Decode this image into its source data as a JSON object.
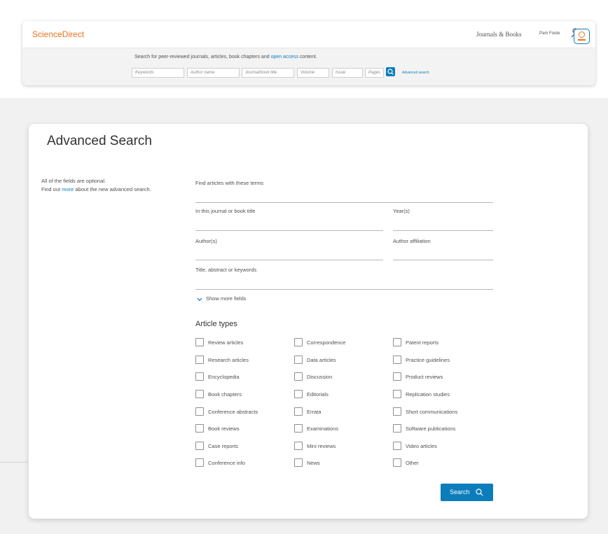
{
  "header": {
    "brand": "ScienceDirect",
    "journals_books": "Journals & Books",
    "user_name": "Pam Foote",
    "search_intro": "Search for peer-reviewed journals, articles, book chapters and",
    "search_intro_link": "open access",
    "search_intro_end": "content.",
    "quick_search": {
      "keywords": "Keywords",
      "author": "Author name",
      "journal": "Journal/book title",
      "volume": "Volume",
      "issue": "Issue",
      "pages": "Pages"
    },
    "advanced_link": "Advanced search"
  },
  "advanced": {
    "title": "Advanced Search",
    "note_line1": "All of the fields are optional.",
    "note_find": "Find out",
    "note_more": "more",
    "note_rest": "about the new advanced search.",
    "fields": {
      "terms": "Find articles with these terms",
      "journal": "In this journal or book title",
      "years": "Year(s)",
      "authors": "Author(s)",
      "affiliation": "Author affiliation",
      "title_abstract": "Title, abstract or keywords"
    },
    "show_more": "Show more fields",
    "article_types_heading": "Article types",
    "article_types": [
      [
        "Review articles",
        "Correspondence",
        "Patent reports"
      ],
      [
        "Research articles",
        "Data articles",
        "Practice guidelines"
      ],
      [
        "Encyclopedia",
        "Discussion",
        "Product reviews"
      ],
      [
        "Book chapters",
        "Editorials",
        "Replication studies"
      ],
      [
        "Conference abstracts",
        "Errata",
        "Short communications"
      ],
      [
        "Book reviews",
        "Examinations",
        "Software publications"
      ],
      [
        "Case reports",
        "Mini reviews",
        "Video articles"
      ],
      [
        "Conference info",
        "News",
        "Other"
      ]
    ],
    "search_button": "Search"
  },
  "colors": {
    "brand_orange": "#e9711c",
    "link_blue": "#0c7dbb",
    "text": "#505050"
  },
  "icons": [
    "user-icon",
    "institution-icon",
    "search-icon",
    "chevron-down-icon"
  ]
}
